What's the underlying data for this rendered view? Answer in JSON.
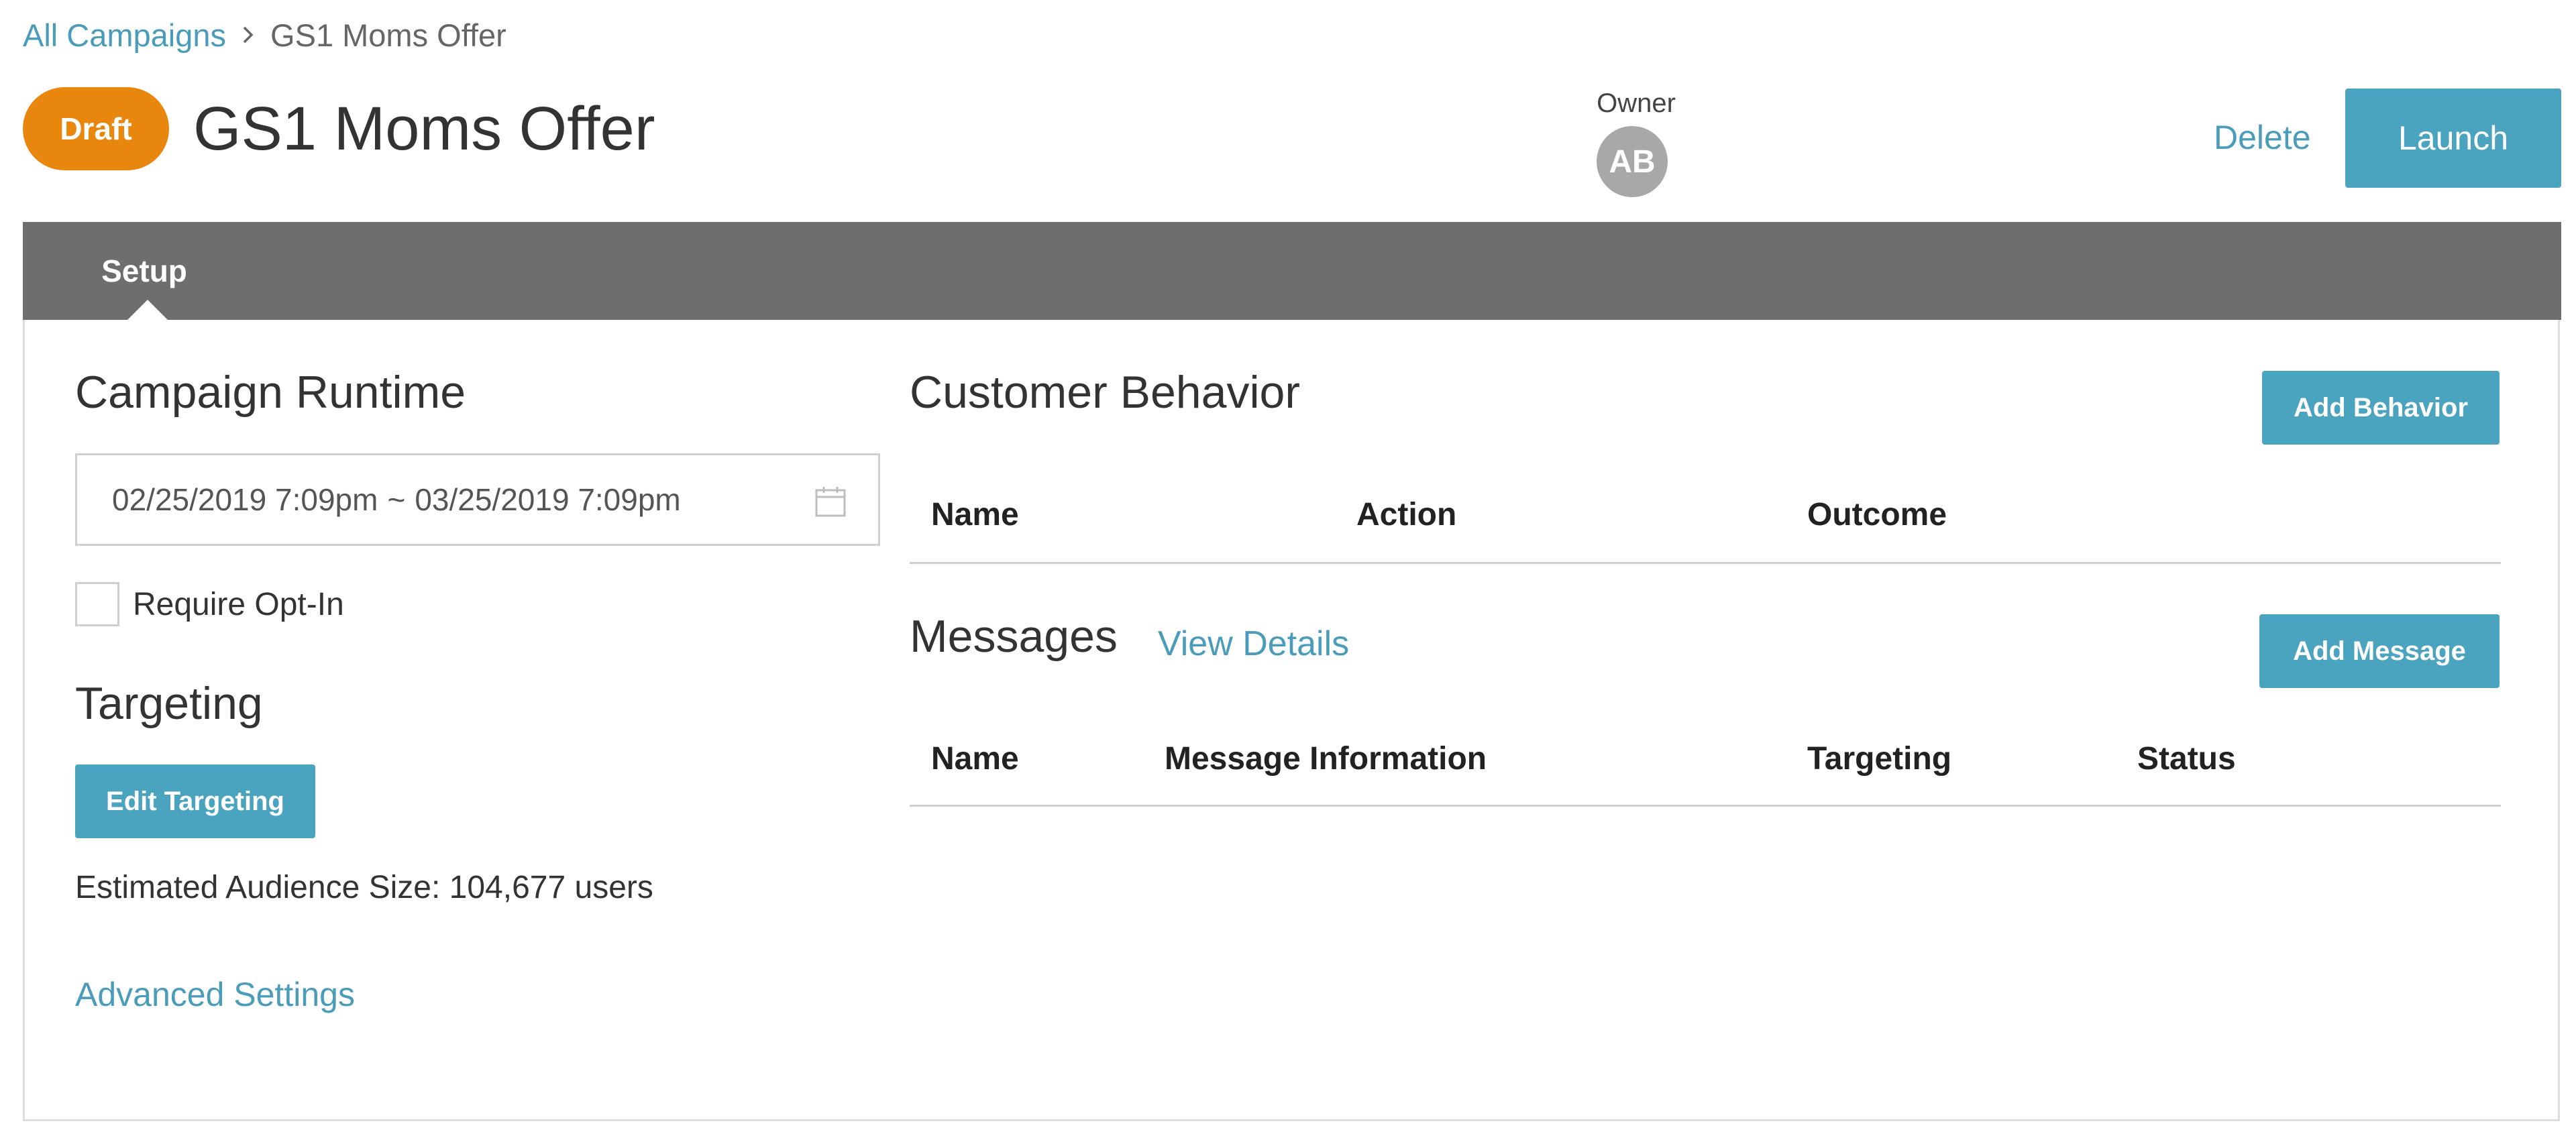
{
  "breadcrumb": {
    "root": "All Campaigns",
    "current": "GS1 Moms Offer"
  },
  "header": {
    "status_badge": "Draft",
    "title": "GS1 Moms Offer",
    "owner_label": "Owner",
    "owner_initials": "AB",
    "delete_label": "Delete",
    "launch_label": "Launch"
  },
  "tabs": [
    {
      "label": "Setup",
      "active": true
    }
  ],
  "runtime": {
    "title": "Campaign Runtime",
    "start": "02/25/2019 7:09pm",
    "separator": "~",
    "end": "03/25/2019 7:09pm",
    "opt_in_label": "Require Opt-In",
    "opt_in_checked": false
  },
  "targeting": {
    "title": "Targeting",
    "edit_label": "Edit Targeting",
    "audience_text": "Estimated Audience Size: 104,677 users",
    "advanced_label": "Advanced Settings"
  },
  "behavior": {
    "title": "Customer Behavior",
    "add_label": "Add Behavior",
    "columns": [
      "Name",
      "Action",
      "Outcome"
    ]
  },
  "messages": {
    "title": "Messages",
    "view_details_label": "View Details",
    "add_label": "Add Message",
    "columns": [
      "Name",
      "Message Information",
      "Targeting",
      "Status"
    ]
  },
  "colors": {
    "accent": "#4aa3bf",
    "link": "#4a9cba",
    "draft": "#e9860e",
    "tabbar": "#6e6e6e"
  }
}
